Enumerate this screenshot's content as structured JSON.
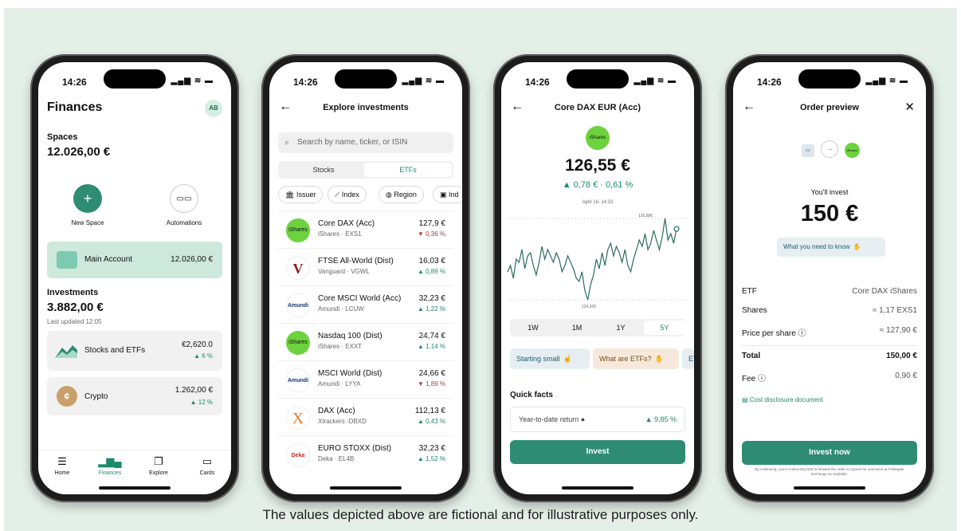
{
  "status": {
    "time": "14:26",
    "icons": "▂▄▆ ≋ ▬"
  },
  "footnote": "The values depicted above are fictional and for illustrative purposes only.",
  "colors": {
    "background": "#e5efe9",
    "accent": "#2e8c73",
    "positive": "#1b8a6b",
    "negative": "#b23a3a",
    "ishares": "#6cd23e"
  },
  "finances": {
    "title": "Finances",
    "avatar": "AB",
    "spaces_label": "Spaces",
    "spaces_value": "12.026,00 €",
    "new_space": "New Space",
    "automations": "Automations",
    "main_account_label": "Main Account",
    "main_account_value": "12.026,00 €",
    "investments_label": "Investments",
    "investments_value": "3.882,00 €",
    "last_updated": "Last updated 12:05",
    "stocks_label": "Stocks and ETFs",
    "stocks_value": "€2,620.0",
    "stocks_change": "▲ 6 %",
    "crypto_label": "Crypto",
    "crypto_value": "1.262,00 €",
    "crypto_change": "▲ 12 %",
    "tabs": [
      "Home",
      "Finances",
      "Explore",
      "Cards"
    ]
  },
  "explore": {
    "title": "Explore investments",
    "search_placeholder": "Search by name, ticker, or ISIN",
    "seg_stocks": "Stocks",
    "seg_etfs": "ETFs",
    "chips": [
      "Issuer",
      "Index",
      "Region",
      "Ind"
    ],
    "rows": [
      {
        "logo": "iShares",
        "name": "Core DAX (Acc)",
        "sub": "iShares · EXS1",
        "price": "127,9 €",
        "change": "▼ 0,36 %",
        "dir": "down"
      },
      {
        "logo": "V",
        "name": "FTSE All-World (Dist)",
        "sub": "Vanguard · VGWL",
        "price": "16,03 €",
        "change": "▲ 0,89 %",
        "dir": "up"
      },
      {
        "logo": "Amundi",
        "name": "Core MSCI World (Acc)",
        "sub": "Amundi · LCUW",
        "price": "32,23 €",
        "change": "▲ 1,22 %",
        "dir": "up"
      },
      {
        "logo": "iShares",
        "name": "Nasdaq 100 (Dist)",
        "sub": "iShares · EXXT",
        "price": "24,74 €",
        "change": "▲ 1,14 %",
        "dir": "up"
      },
      {
        "logo": "Amundi",
        "name": "MSCI World (Dist)",
        "sub": "Amundi · LYYA",
        "price": "24,66 €",
        "change": "▼ 1,89 %",
        "dir": "down"
      },
      {
        "logo": "X",
        "name": "DAX (Acc)",
        "sub": "Xtrackers ·DBXD",
        "price": "112,13 €",
        "change": "▲ 0,43 %",
        "dir": "up"
      },
      {
        "logo": "Deka",
        "name": "EURO STOXX (Dist)",
        "sub": "Deka · EL4B",
        "price": "32,23 €",
        "change": "▲ 1,52 %",
        "dir": "up"
      }
    ]
  },
  "detail": {
    "title": "Core DAX EUR (Acc)",
    "logo": "iShares",
    "price": "126,55 €",
    "change": "▲ 0,78 € · 0,61 %",
    "date": "April 16, 14:33",
    "high_label": "126,88€",
    "low_label": "124,32€",
    "periods": [
      "1W",
      "1M",
      "1Y",
      "5Y"
    ],
    "active_period": "5Y",
    "pill_starting": "Starting small",
    "pill_etfs": "What are ETFs?",
    "pill_more": "ET",
    "quick_facts": "Quick facts",
    "ytd_label": "Year-to-date return",
    "ytd_value": "▲ 9,85 %",
    "invest": "Invest"
  },
  "chart_data": {
    "type": "line",
    "title": "",
    "series": [
      {
        "values": [
          125.2,
          125.4,
          125.0,
          125.6,
          125.5,
          125.9,
          125.3,
          125.7,
          125.8,
          125.4,
          125.1,
          125.5,
          126.0,
          125.6,
          125.9,
          125.7,
          125.5,
          125.8,
          125.6,
          125.2,
          125.4,
          125.7,
          125.5,
          125.3,
          125.0,
          124.9,
          125.2,
          124.6,
          124.32,
          124.8,
          125.1,
          125.6,
          125.3,
          125.8,
          125.4,
          125.9,
          126.1,
          125.7,
          126.0,
          125.8,
          125.5,
          125.9,
          125.4,
          125.2,
          125.6,
          125.9,
          126.2,
          126.0,
          126.4,
          125.9,
          126.1,
          126.5,
          126.2,
          125.9,
          126.3,
          126.88,
          126.2,
          126.4,
          126.1,
          126.55
        ]
      }
    ],
    "ylim": [
      124.32,
      126.88
    ]
  },
  "order": {
    "title": "Order preview",
    "logo": "iShares",
    "you_invest": "You'll invest",
    "amount": "150 €",
    "need_to_know": "What you need to know",
    "rows": [
      {
        "label": "ETF",
        "value": "Core DAX iShares"
      },
      {
        "label": "Shares",
        "value": "≈ 1,17 EXS1"
      },
      {
        "label": "Price per share",
        "value": "≈ 127,90 €"
      }
    ],
    "total_label": "Total",
    "total_value": "150,00 €",
    "fee_label": "Fee",
    "fee_value": "0,90 €",
    "cost_doc": "Cost disclosure document",
    "invest_now": "Invest now",
    "disclaimer": "By continuing, you're instructing N26 to forward the order to Upvest for execution at Tradegate Exchange as available."
  }
}
